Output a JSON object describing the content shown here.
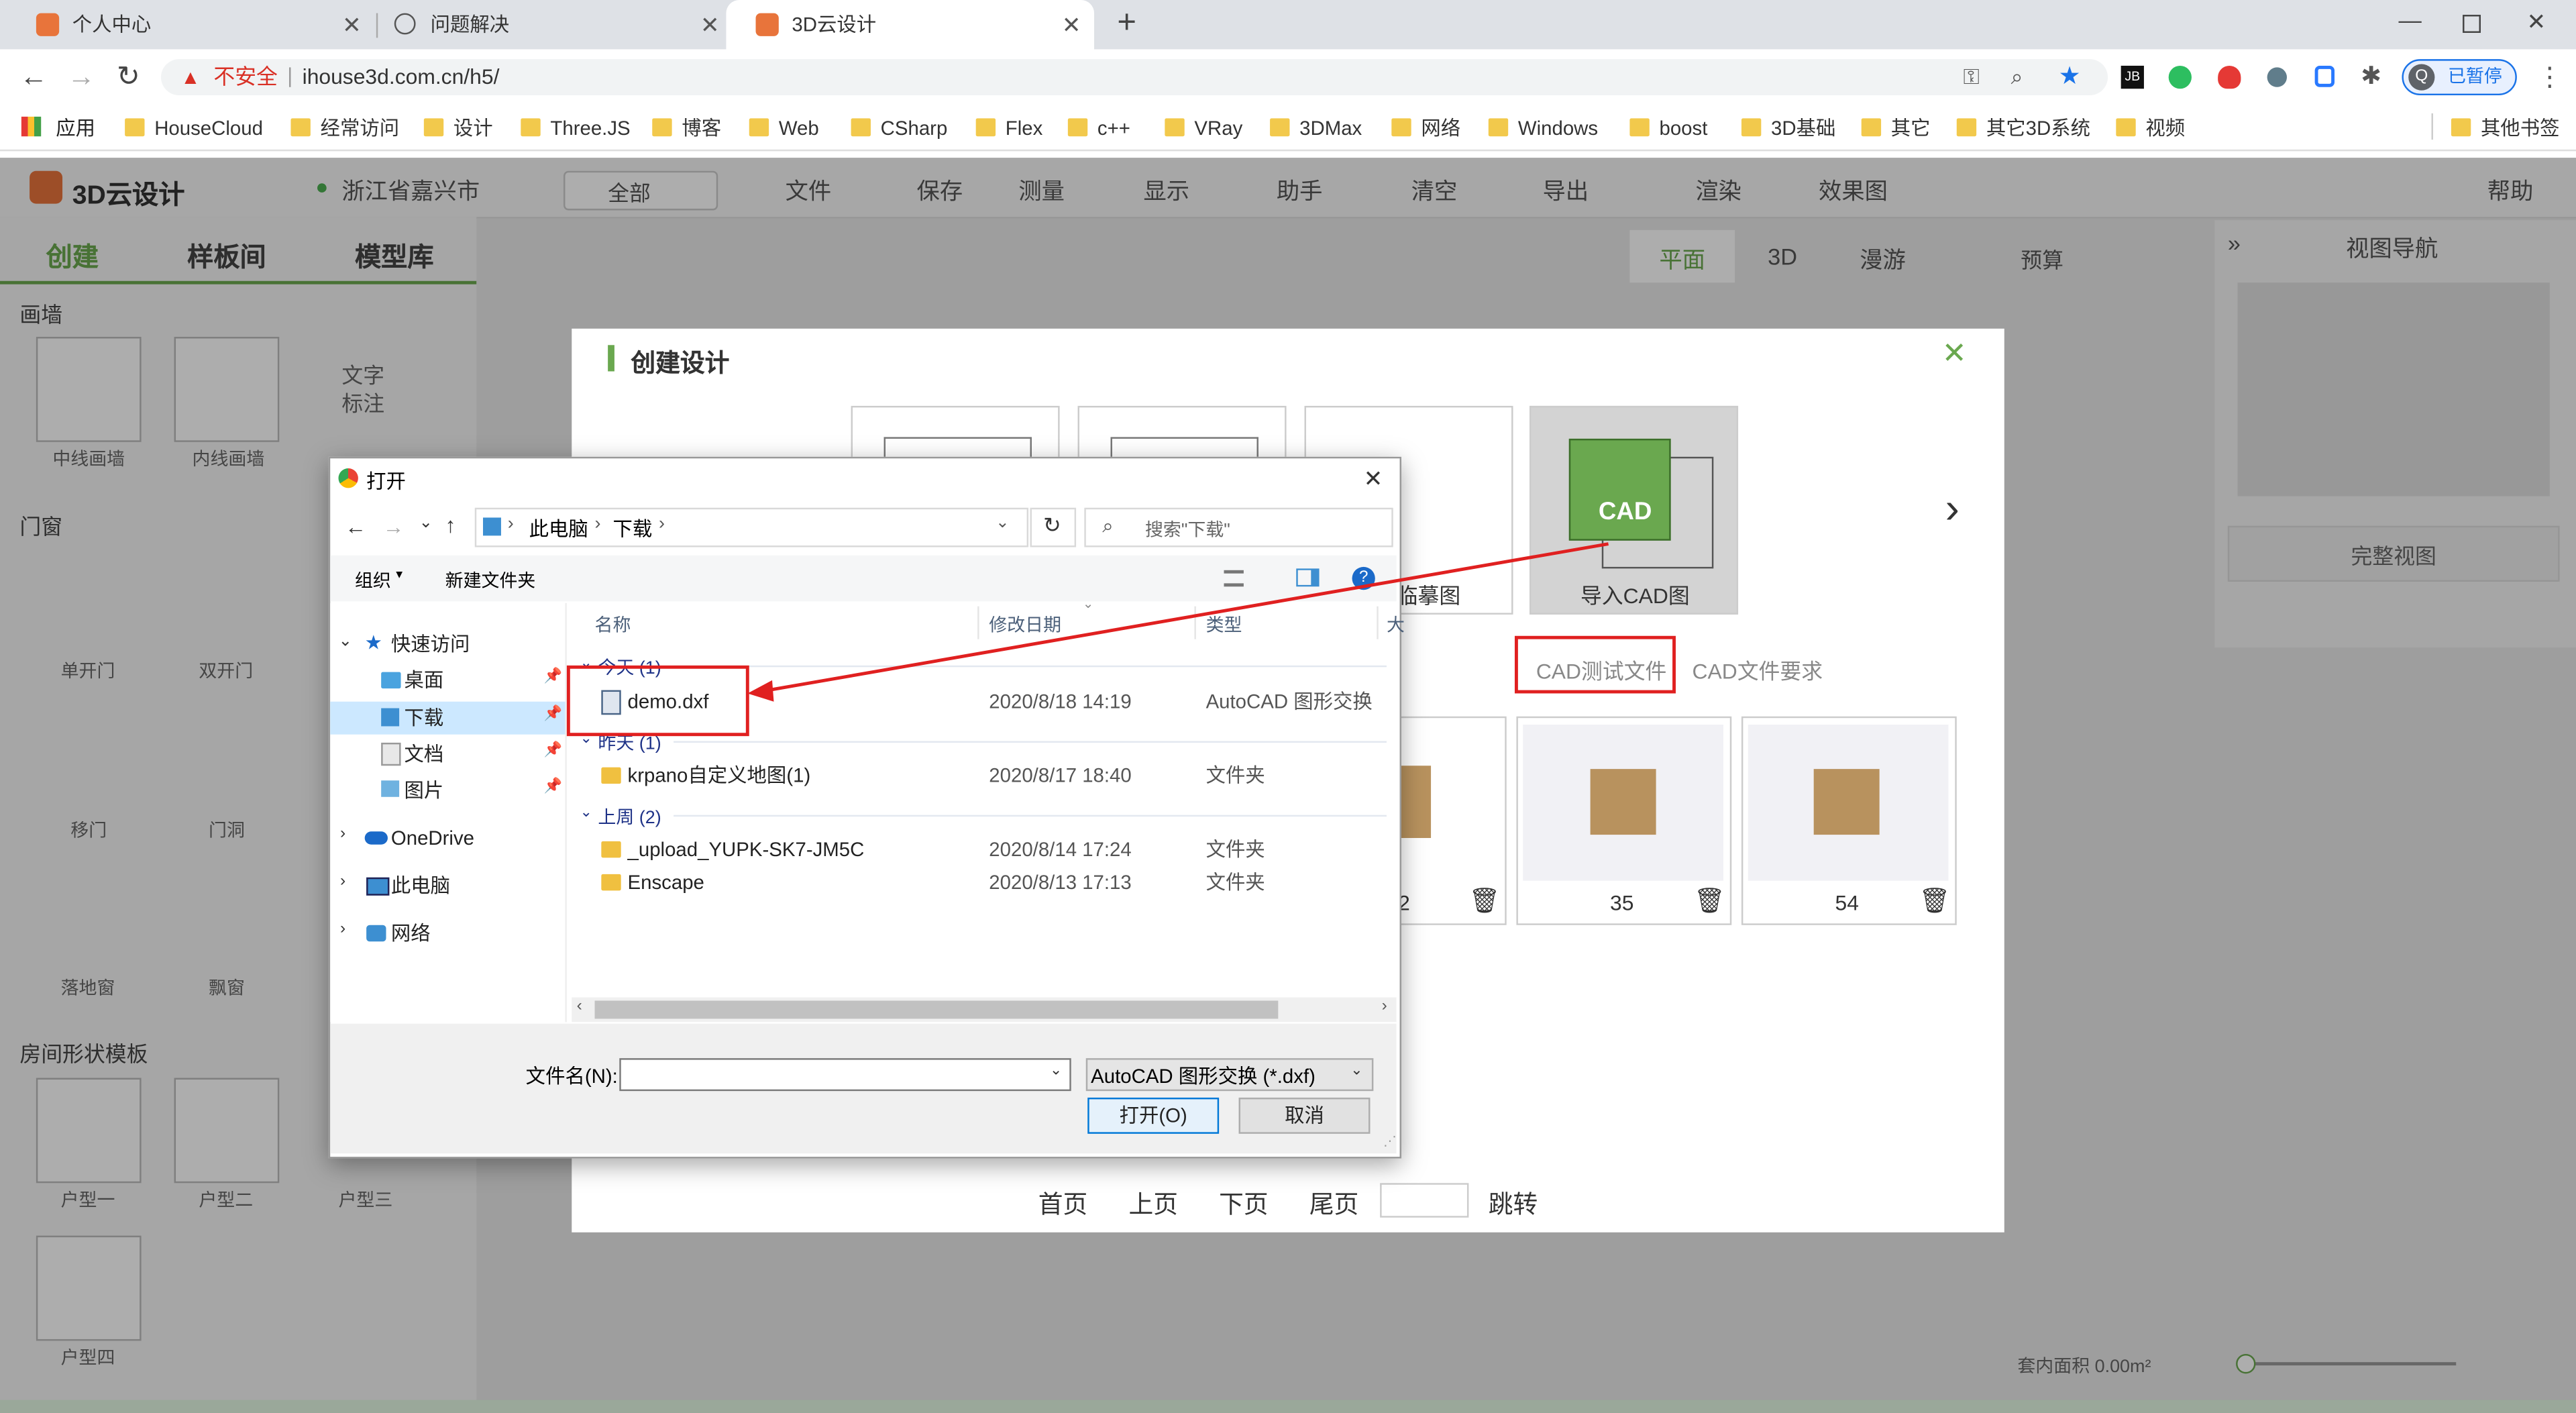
{
  "browser": {
    "tabs": [
      {
        "title": "个人中心"
      },
      {
        "title": "问题解决"
      },
      {
        "title": "3D云设计"
      }
    ],
    "new_tab": "+",
    "url_warning": "不安全",
    "url": "ihouse3d.com.cn/h5/",
    "profile_label": "已暂停",
    "profile_initial": "Q",
    "bookmarks": [
      "应用",
      "HouseCloud",
      "经常访问",
      "设计",
      "Three.JS",
      "博客",
      "Web",
      "CSharp",
      "Flex",
      "c++",
      "VRay",
      "3DMax",
      "网络",
      "Windows",
      "boost",
      "3D基础",
      "其它",
      "其它3D系统",
      "视频"
    ],
    "other_bookmarks": "其他书签"
  },
  "app": {
    "logo": "3D云设计",
    "location": "浙江省嘉兴市",
    "scope": "全部",
    "toolbar": [
      "文件",
      "保存",
      "测量",
      "显示",
      "助手",
      "清空",
      "导出",
      "渲染",
      "效果图"
    ],
    "help": "帮助",
    "left_tabs": [
      "创建",
      "样板间",
      "模型库"
    ],
    "view_tabs": [
      "平面",
      "3D",
      "漫游"
    ],
    "budget": "预算",
    "view_nav": "视图导航",
    "full_view": "完整视图",
    "sections": {
      "wall": "画墙",
      "door": "门窗",
      "room": "房间形状模板"
    },
    "wall_items": [
      "中线画墙",
      "内线画墙",
      "文字标注"
    ],
    "door_items": [
      "单开门",
      "双开门",
      "移门",
      "门洞",
      "落地窗",
      "飘窗"
    ],
    "room_items": [
      "户型一",
      "户型二",
      "户型三",
      "户型四"
    ],
    "area_label": "套内面积 0.00m²"
  },
  "modal": {
    "title": "创建设计",
    "cad_icon_label": "CAD",
    "cards": [
      "临摹图",
      "导入CAD图"
    ],
    "links": [
      "CAD测试文件",
      "CAD文件要求"
    ],
    "thumbs": [
      "2",
      "35",
      "54"
    ],
    "pager": [
      "首页",
      "上页",
      "下页",
      "尾页",
      "跳转"
    ]
  },
  "dialog": {
    "title": "打开",
    "path": [
      "此电脑",
      "下载"
    ],
    "search_placeholder": "搜索\"下载\"",
    "organize": "组织",
    "new_folder": "新建文件夹",
    "nav": {
      "quick_access": "快速访问",
      "desktop": "桌面",
      "downloads": "下载",
      "documents": "文档",
      "pictures": "图片",
      "onedrive": "OneDrive",
      "this_pc": "此电脑",
      "network": "网络"
    },
    "columns": [
      "名称",
      "修改日期",
      "类型",
      "大"
    ],
    "groups": [
      "今天 (1)",
      "昨天 (1)",
      "上周 (2)"
    ],
    "files": [
      {
        "name": "demo.dxf",
        "date": "2020/8/18 14:19",
        "type": "AutoCAD 图形交换"
      },
      {
        "name": "krpano自定义地图(1)",
        "date": "2020/8/17 18:40",
        "type": "文件夹"
      },
      {
        "name": "_upload_YUPK-SK7-JM5C",
        "date": "2020/8/14 17:24",
        "type": "文件夹"
      },
      {
        "name": "Enscape",
        "date": "2020/8/13 17:13",
        "type": "文件夹"
      }
    ],
    "filename_label": "文件名(N):",
    "filetype": "AutoCAD 图形交换 (*.dxf)",
    "open_button": "打开(O)",
    "cancel_button": "取消"
  }
}
